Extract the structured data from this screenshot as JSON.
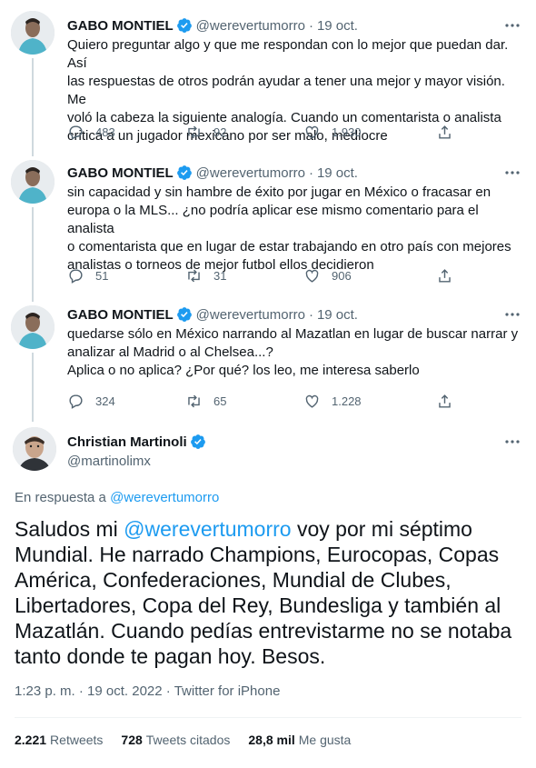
{
  "thread": [
    {
      "name": "GABO MONTIEL",
      "handle": "@werevertumorro",
      "date": "19 oct.",
      "text": "Quiero preguntar algo y que me respondan con lo mejor que puedan dar. Así\nlas respuestas de otros podrán ayudar a tener una mejor y mayor visión. Me\nvoló la cabeza la siguiente analogía. Cuando un comentarista o analista\ncritica a un jugador mexicano por ser malo, mediocre",
      "replies": "483",
      "retweets": "92",
      "likes": "1.930"
    },
    {
      "name": "GABO MONTIEL",
      "handle": "@werevertumorro",
      "date": "19 oct.",
      "text": "sin capacidad y sin hambre de éxito por jugar en México o fracasar en\neuropa o la MLS... ¿no podría aplicar ese mismo comentario para el analista\no comentarista que en lugar de estar trabajando en otro país con mejores\nanalistas o torneos de mejor futbol ellos decidieron",
      "replies": "51",
      "retweets": "31",
      "likes": "906"
    },
    {
      "name": "GABO MONTIEL",
      "handle": "@werevertumorro",
      "date": "19 oct.",
      "text": "quedarse sólo en México narrando al Mazatlan en lugar de buscar narrar y\nanalizar al Madrid o al Chelsea...?\nAplica o no aplica? ¿Por qué? los leo, me interesa saberlo",
      "replies": "324",
      "retweets": "65",
      "likes": "1.228"
    }
  ],
  "main": {
    "name": "Christian Martinoli",
    "handle": "@martinolimx",
    "reply_prefix": "En respuesta a",
    "reply_mention": "@werevertumorro",
    "text_before": "Saludos mi ",
    "text_mention": "@werevertumorro",
    "text_after": " voy por mi séptimo Mundial. He narrado Champions, Eurocopas, Copas América, Confederaciones, Mundial de Clubes, Libertadores, Copa del Rey, Bundesliga y también al Mazatlán. Cuando pedías entrevistarme no se notaba tanto donde te pagan hoy. Besos.",
    "time": "1:23 p. m.",
    "sep": "·",
    "date": "19 oct. 2022",
    "source": "Twitter for iPhone",
    "retweets_count": "2.221",
    "retweets_label": "Retweets",
    "quotes_count": "728",
    "quotes_label": "Tweets citados",
    "likes_count": "28,8 mil",
    "likes_label": "Me gusta"
  },
  "colors": {
    "accent": "#1d9bf0",
    "secondary_text": "#536471",
    "primary_text": "#0f1419",
    "thread_line": "#cfd9de"
  },
  "icons": [
    "verified-badge-icon",
    "more-icon",
    "reply-icon",
    "retweet-icon",
    "like-icon",
    "share-icon"
  ]
}
